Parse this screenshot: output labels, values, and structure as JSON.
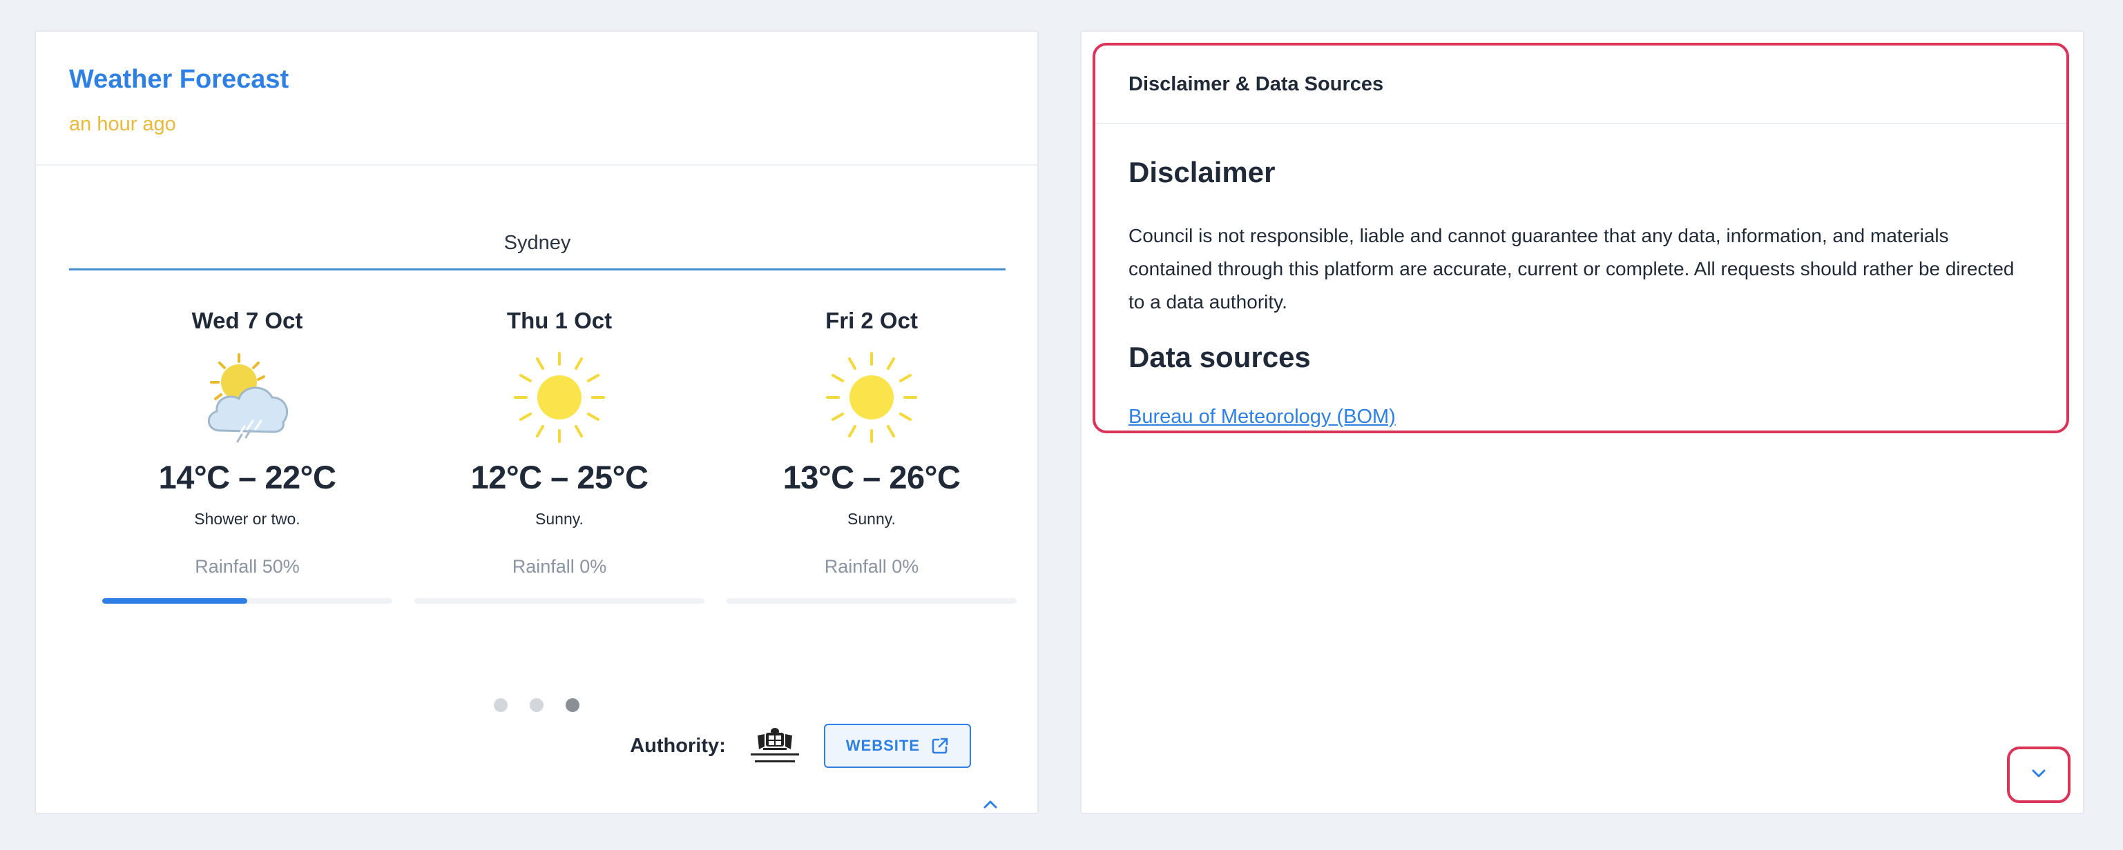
{
  "weather": {
    "title": "Weather Forecast",
    "updated": "an hour ago",
    "location": "Sydney",
    "days": [
      {
        "label": "Wed 7 Oct",
        "icon": "sun-cloud-rain-icon",
        "temps": "14°C – 22°C",
        "desc": "Shower or two.",
        "rain": "Rainfall 50%",
        "rain_pct": 50
      },
      {
        "label": "Thu 1 Oct",
        "icon": "sun-icon",
        "temps": "12°C – 25°C",
        "desc": "Sunny.",
        "rain": "Rainfall 0%",
        "rain_pct": 0
      },
      {
        "label": "Fri 2 Oct",
        "icon": "sun-icon",
        "temps": "13°C – 26°C",
        "desc": "Sunny.",
        "rain": "Rainfall 0%",
        "rain_pct": 0
      }
    ],
    "carousel": {
      "count": 3,
      "active_index": 2
    },
    "authority_label": "Authority:",
    "authority_logo": "bom-crest-logo",
    "website_label": "WEBSITE"
  },
  "disclaimer": {
    "header": "Disclaimer & Data Sources",
    "heading": "Disclaimer",
    "body": "Council is not responsible, liable and cannot guarantee that any data, information, and materials contained through this platform are accurate, current or complete. All requests should rather be directed to a data authority.",
    "sources_heading": "Data sources",
    "source_link": "Bureau of Meteorology (BOM)"
  },
  "colors": {
    "accent": "#2f80e4",
    "timestamp": "#e8b93a",
    "highlight": "#dc3359",
    "sun": "#fbe34b"
  }
}
